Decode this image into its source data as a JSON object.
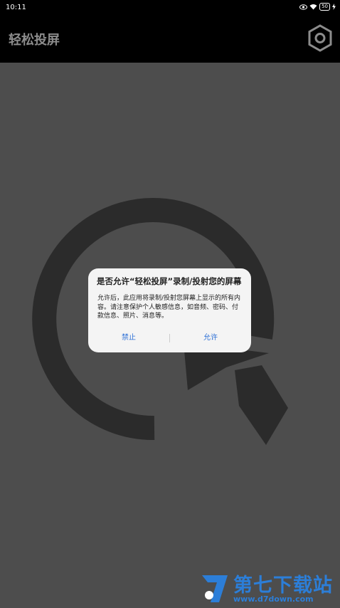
{
  "status_bar": {
    "time": "10:11",
    "battery": "50"
  },
  "app_bar": {
    "title": "轻松投屏"
  },
  "dialog": {
    "title": "是否允许“轻松投屏”录制/投射您的屏幕",
    "message": "允许后，此应用将录制/投射您屏幕上显示的所有内容。请注意保护个人敏感信息，如音频、密码、付款信息、照片、消息等。",
    "deny_label": "禁止",
    "allow_label": "允许"
  },
  "watermark": {
    "brand": "第七下载站",
    "url": "www.d7down.com"
  },
  "colors": {
    "background": "#4d4d4d",
    "art": "#2b2b2b",
    "dialog_button": "#2c6fd6",
    "watermark": "#2c7ed8"
  }
}
